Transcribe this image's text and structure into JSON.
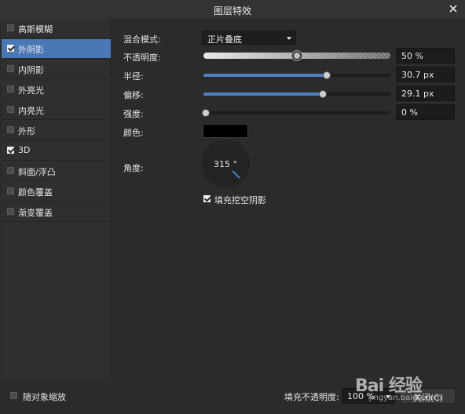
{
  "window": {
    "title": "图层特效"
  },
  "sidebar": {
    "items": [
      {
        "label": "高斯模糊",
        "checked": false,
        "active": false
      },
      {
        "label": "外阴影",
        "checked": true,
        "active": true
      },
      {
        "label": "内阴影",
        "checked": false,
        "active": false
      },
      {
        "label": "外亮光",
        "checked": false,
        "active": false
      },
      {
        "label": "内亮光",
        "checked": false,
        "active": false
      },
      {
        "label": "外形",
        "checked": false,
        "active": false
      },
      {
        "label": "3D",
        "checked": true,
        "active": false
      },
      {
        "label": "斜面/浮凸",
        "checked": false,
        "active": false
      },
      {
        "label": "颜色覆盖",
        "checked": false,
        "active": false
      },
      {
        "label": "渐变覆盖",
        "checked": false,
        "active": false
      }
    ]
  },
  "panel": {
    "blend_mode": {
      "label": "混合模式:",
      "value": "正片叠底"
    },
    "opacity": {
      "label": "不透明度:",
      "value": "50 %",
      "level": 0.5
    },
    "radius": {
      "label": "半径:",
      "value": "30.7 px",
      "level": 0.66
    },
    "offset": {
      "label": "偏移:",
      "value": "29.1 px",
      "level": 0.64
    },
    "intensity": {
      "label": "强度:",
      "value": "0 %",
      "level": 0.0
    },
    "color": {
      "label": "颜色:",
      "swatch": "#000000"
    },
    "angle": {
      "label": "角度:",
      "value": "315 °"
    },
    "fill_knockout": {
      "label": "填充挖空阴影",
      "checked": true
    }
  },
  "footer": {
    "scale_with_object": {
      "label": "随对象缩放",
      "checked": false
    },
    "fill_opacity": {
      "label": "填充不透明度:",
      "value": "100 %"
    },
    "close_label": "关闭(C)"
  },
  "watermark": {
    "brand": "Bai 经验",
    "url": "jingyan.baidu.com"
  },
  "colors": {
    "accent": "#4a78b5",
    "slider_fill": "#4d7fc2"
  }
}
